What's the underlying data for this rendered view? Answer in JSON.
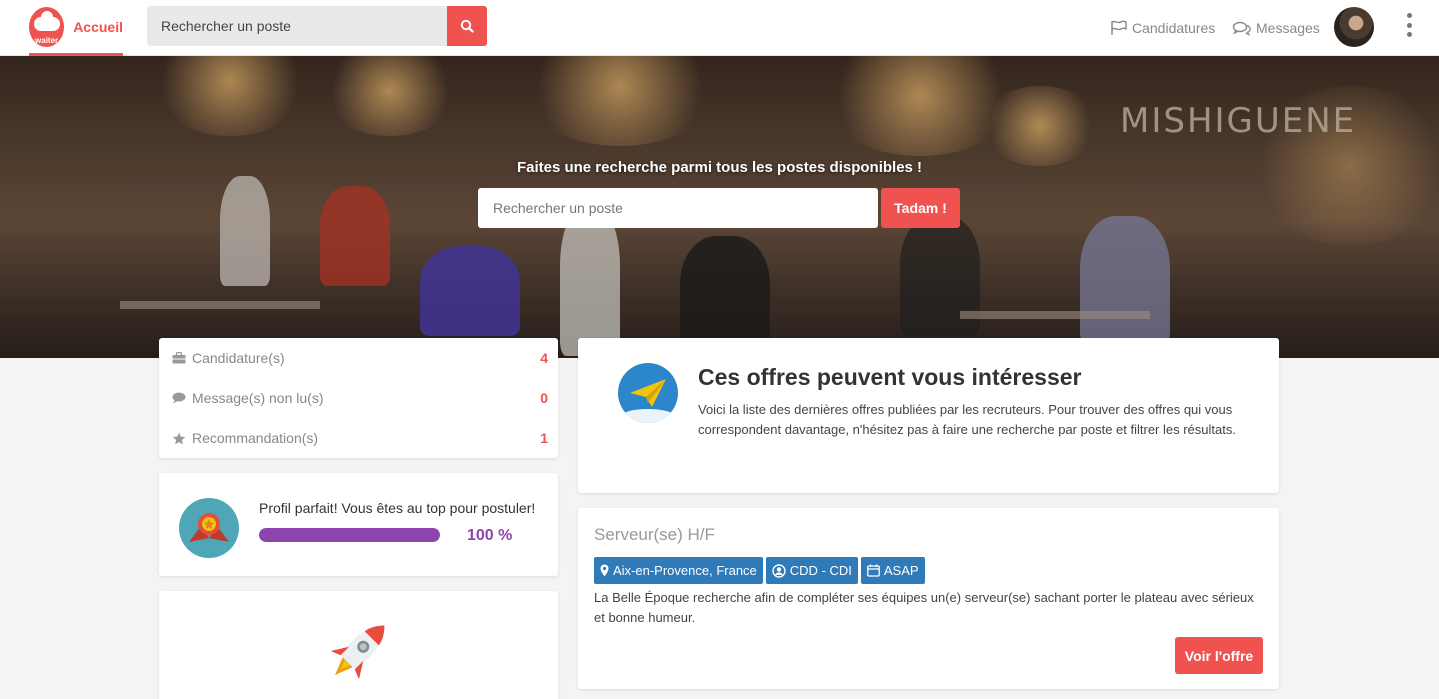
{
  "nav": {
    "brand_label": "Accueil",
    "logo_text": "waiter",
    "search_placeholder": "Rechercher un poste",
    "applications_label": "Candidatures",
    "messages_label": "Messages"
  },
  "hero": {
    "title": "Faites une recherche parmi tous les postes disponibles !",
    "search_placeholder": "Rechercher un poste",
    "button_label": "Tadam !",
    "sign_text": "MISHIGUENE"
  },
  "stats": [
    {
      "icon": "briefcase-icon",
      "label": "Candidature(s)",
      "count": "4"
    },
    {
      "icon": "comment-icon",
      "label": "Message(s) non lu(s)",
      "count": "0"
    },
    {
      "icon": "star-icon",
      "label": "Recommandation(s)",
      "count": "1"
    }
  ],
  "profile": {
    "text": "Profil parfait! Vous êtes au top pour postuler!",
    "progress": 1.0,
    "percent_label": "100 %"
  },
  "intro": {
    "title": "Ces offres peuvent vous intéresser",
    "text": "Voici la liste des dernières offres publiées par les recruteurs. Pour trouver des offres qui vous correspondent davantage, n'hésitez pas à faire une recherche par poste et filtrer les résultats."
  },
  "job": {
    "title": "Serveur(se) H/F",
    "tags": [
      {
        "icon": "map-marker-icon",
        "label": "Aix-en-Provence, France"
      },
      {
        "icon": "user-circle-icon",
        "label": "CDD - CDI"
      },
      {
        "icon": "calendar-icon",
        "label": "ASAP"
      }
    ],
    "description": "La Belle Époque recherche afin de compléter ses équipes un(e) serveur(se) sachant porter le plateau avec sérieux et bonne humeur.",
    "button_label": "Voir l'offre"
  },
  "colors": {
    "accent": "#f0524f",
    "tag_blue": "#2f7ab8",
    "progress_purple": "#8e44ad"
  }
}
